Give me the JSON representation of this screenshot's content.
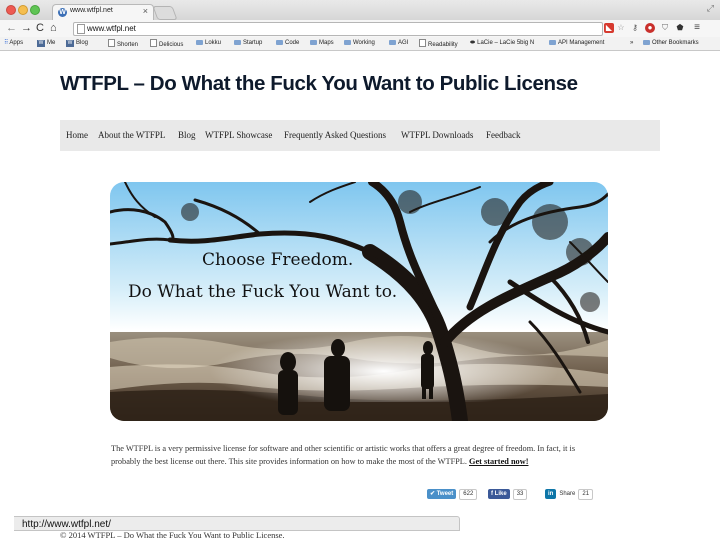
{
  "browser": {
    "tab_title": "www.wtfpl.net",
    "tab_close": "×",
    "tab_favicon": "W",
    "url": "www.wtfpl.net",
    "bookmarks": [
      {
        "label": "Apps",
        "icon": "apps-grid-icon"
      },
      {
        "label": "Me",
        "icon": "w-icon"
      },
      {
        "label": "Blog",
        "icon": "w-icon"
      },
      {
        "label": "Shorten",
        "icon": "page-icon"
      },
      {
        "label": "Delicious",
        "icon": "page-icon"
      },
      {
        "label": "Lokku",
        "icon": "folder-icon"
      },
      {
        "label": "Startup",
        "icon": "folder-icon"
      },
      {
        "label": "Code",
        "icon": "folder-icon"
      },
      {
        "label": "Maps",
        "icon": "folder-icon"
      },
      {
        "label": "Working",
        "icon": "folder-icon"
      },
      {
        "label": "AGI",
        "icon": "folder-icon"
      },
      {
        "label": "Readability",
        "icon": "page-icon"
      },
      {
        "label": "LaCie – LaCie 5big N",
        "icon": "lacie-icon"
      },
      {
        "label": "API Management",
        "icon": "folder-icon"
      },
      {
        "label": "»",
        "icon": ""
      },
      {
        "label": "Other Bookmarks",
        "icon": "folder-icon"
      }
    ]
  },
  "page": {
    "title": "WTFPL – Do What the Fuck You Want to Public License",
    "nav": [
      "Home",
      "About the WTFPL",
      "Blog",
      "WTFPL Showcase",
      "Frequently Asked Questions",
      "WTFPL Downloads",
      "Feedback"
    ],
    "hero": {
      "line1": "Choose Freedom.",
      "line2": "Do What the Fuck You Want to."
    },
    "intro_text": "The WTFPL is a very permissive license for software and other scientific or artistic works that offers a great degree of freedom. In fact, it is probably the best license out there. This site provides information on how to make the most of the WTFPL. ",
    "intro_link": "Get started now!",
    "share": {
      "tweet_label": "Tweet",
      "tweet_count": "622",
      "like_label": "Like",
      "like_count": "33",
      "linkedin_label": "in",
      "linkedin_text": "Share",
      "linkedin_count": "21"
    },
    "footer": "© 2014 WTFPL – Do What the Fuck You Want to Public License."
  },
  "status_url": "http://www.wtfpl.net/",
  "colors": {
    "nav_bg": "#e9e9e9",
    "title": "#0e1a2c",
    "twitter": "#4a90c9",
    "facebook": "#3b5998",
    "linkedin": "#0e76a8"
  }
}
